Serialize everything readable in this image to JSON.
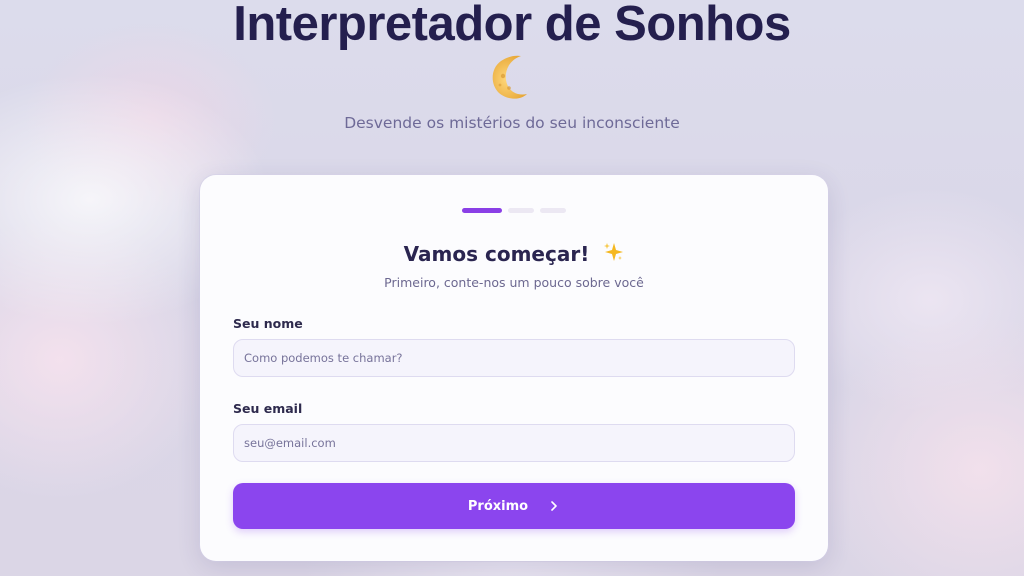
{
  "header": {
    "title": "Interpretador de Sonhos",
    "subtitle": "Desvende os mistérios do seu inconsciente"
  },
  "icons": {
    "moon": "crescent-moon-icon",
    "sparkle": "sparkles-icon",
    "next": "chevron-right-icon"
  },
  "progress": {
    "current_step": 1,
    "total_steps": 3
  },
  "form": {
    "title": "Vamos começar!",
    "subtitle": "Primeiro, conte-nos um pouco sobre você",
    "name": {
      "label": "Seu nome",
      "placeholder": "Como podemos te chamar?",
      "value": ""
    },
    "email": {
      "label": "Seu email",
      "placeholder": "seu@email.com",
      "value": ""
    },
    "next_label": "Próximo"
  },
  "colors": {
    "accent": "#8b45ee",
    "title": "#241f4e",
    "background": "#dcdcec"
  }
}
